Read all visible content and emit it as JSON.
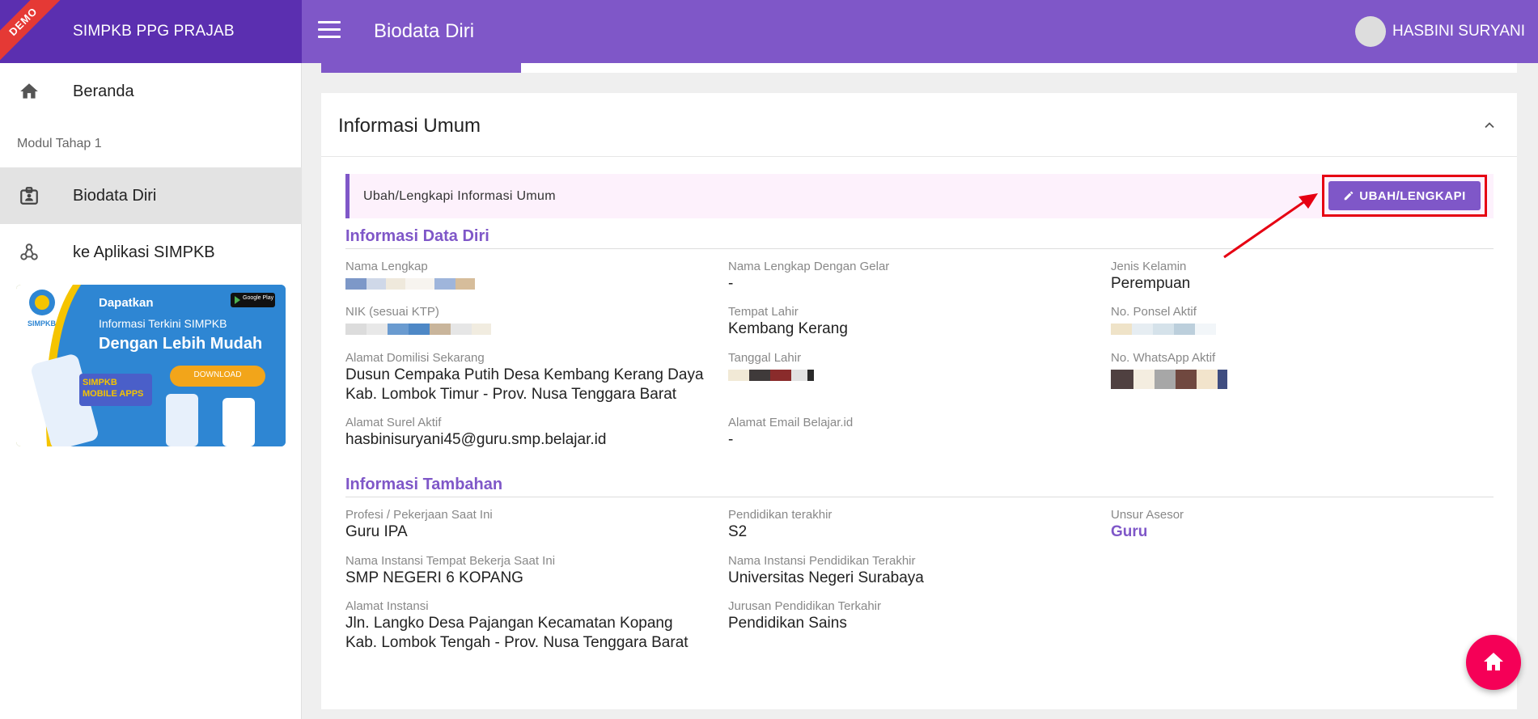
{
  "app": {
    "brand_title": "SIMPKB PPG PRAJAB",
    "ribbon": "DEMO",
    "page_title": "Biodata Diri",
    "user_name": "HASBINI SURYANI"
  },
  "sidebar": {
    "items": [
      {
        "label": "Beranda",
        "icon": "home-icon"
      },
      {
        "label": "Biodata Diri",
        "icon": "badge-icon",
        "active": true
      },
      {
        "label": "ke Aplikasi SIMPKB",
        "icon": "webhook-icon"
      }
    ],
    "section_label": "Modul Tahap 1",
    "banner": {
      "logo_text": "SIMPKB",
      "line1": "Dapatkan",
      "line2": "Informasi Terkini SIMPKB",
      "line3": "Dengan Lebih Mudah",
      "download": "DOWNLOAD",
      "apps": "SIMPKB MOBILE APPS",
      "store": "Google Play"
    }
  },
  "card": {
    "title": "Informasi Umum",
    "notice": "Ubah/Lengkapi Informasi Umum",
    "edit_button": "UBAH/LENGKAPI",
    "section1": "Informasi Data Diri",
    "section2": "Informasi Tambahan",
    "fields1": {
      "nama_lengkap": {
        "label": "Nama Lengkap",
        "value": "HASBINI SURYANI"
      },
      "nama_gelar": {
        "label": "Nama Lengkap Dengan Gelar",
        "value": "-"
      },
      "jenis_kelamin": {
        "label": "Jenis Kelamin",
        "value": "Perempuan"
      },
      "nik": {
        "label": "NIK (sesuai KTP)"
      },
      "tempat_lahir": {
        "label": "Tempat Lahir",
        "value": "Kembang Kerang"
      },
      "ponsel": {
        "label": "No. Ponsel Aktif"
      },
      "alamat_domisili": {
        "label": "Alamat Domilisi Sekarang",
        "line1": "Dusun Cempaka Putih Desa Kembang Kerang Daya",
        "line2": "Kab. Lombok Timur - Prov. Nusa Tenggara Barat"
      },
      "tanggal_lahir": {
        "label": "Tanggal Lahir"
      },
      "whatsapp": {
        "label": "No. WhatsApp Aktif"
      },
      "surel": {
        "label": "Alamat Surel Aktif",
        "value": "hasbinisuryani45@guru.smp.belajar.id"
      },
      "email_belajar": {
        "label": "Alamat Email Belajar.id",
        "value": "-"
      }
    },
    "fields2": {
      "profesi": {
        "label": "Profesi / Pekerjaan Saat Ini",
        "value": "Guru IPA"
      },
      "pendidikan": {
        "label": "Pendidikan terakhir",
        "value": "S2"
      },
      "unsur": {
        "label": "Unsur Asesor",
        "value": "Guru"
      },
      "instansi": {
        "label": "Nama Instansi Tempat Bekerja Saat Ini",
        "value": "SMP NEGERI 6 KOPANG"
      },
      "instansi_pend": {
        "label": "Nama Instansi Pendidikan Terakhir",
        "value": "Universitas Negeri Surabaya"
      },
      "alamat_instansi": {
        "label": "Alamat Instansi",
        "line1": "Jln. Langko Desa Pajangan Kecamatan Kopang",
        "line2": "Kab. Lombok Tengah - Prov. Nusa Tenggara Barat"
      },
      "jurusan": {
        "label": "Jurusan Pendidikan Terkahir",
        "value": "Pendidikan Sains"
      }
    }
  },
  "colors": {
    "brand": "#5b2fb0",
    "topbar": "#7f57c8",
    "accent": "#7f57c8",
    "highlight": "#e60012",
    "fab": "#f50057"
  }
}
